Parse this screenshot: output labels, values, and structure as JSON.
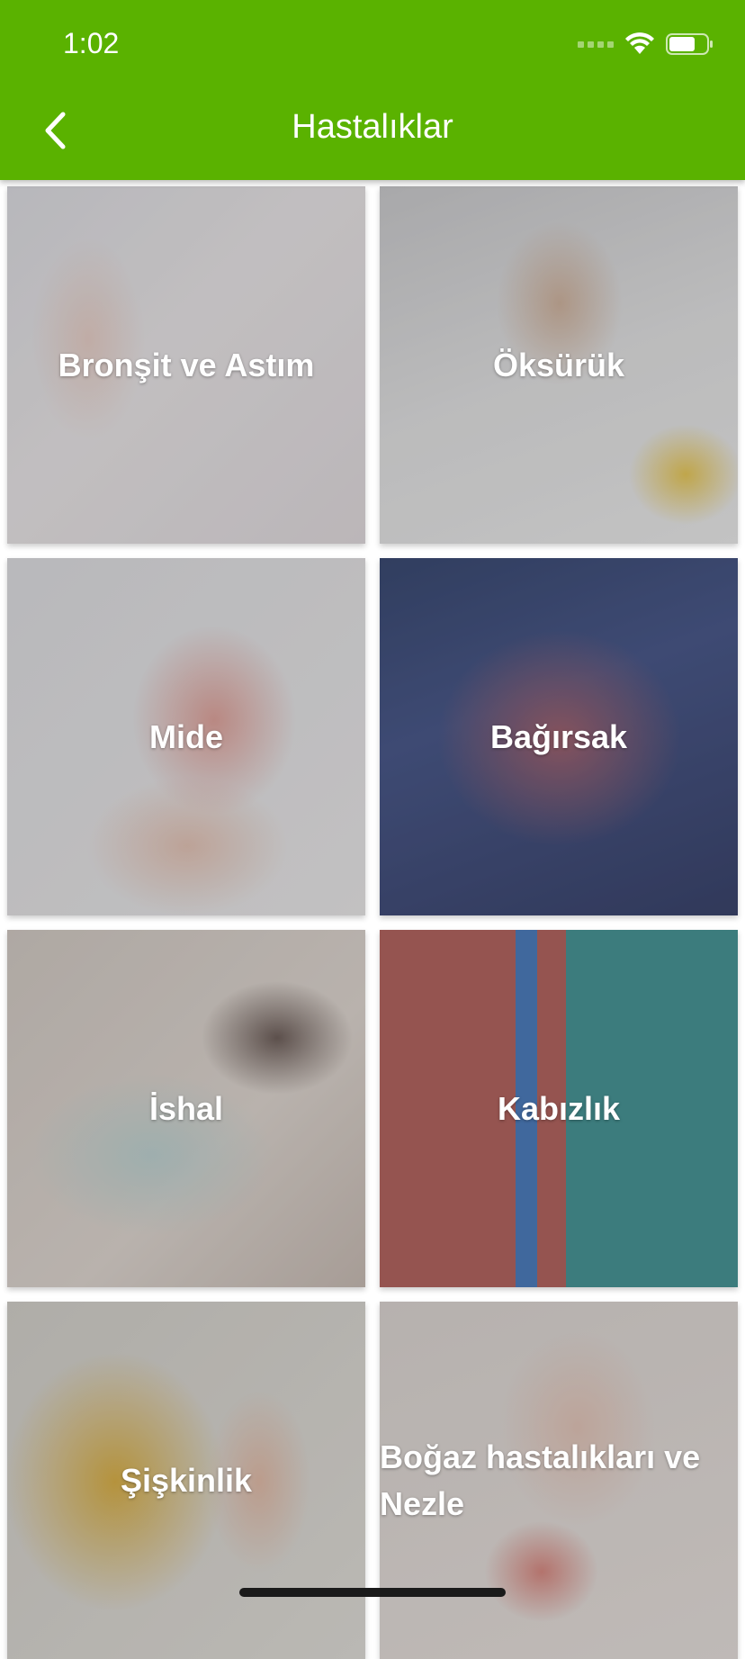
{
  "status_bar": {
    "time": "1:02",
    "icons": [
      "signal-icon",
      "wifi-icon",
      "battery-icon"
    ]
  },
  "header": {
    "title": "Hastalıklar",
    "back_icon": "chevron-left-icon",
    "background_color": "#5ab200"
  },
  "grid": {
    "tiles": [
      {
        "label": "Bronşit ve Astım"
      },
      {
        "label": "Öksürük"
      },
      {
        "label": "Mide"
      },
      {
        "label": "Bağırsak"
      },
      {
        "label": "İshal"
      },
      {
        "label": "Kabızlık"
      },
      {
        "label": "Şişkinlik"
      },
      {
        "label": "Boğaz hastalıkları ve Nezle"
      }
    ]
  }
}
